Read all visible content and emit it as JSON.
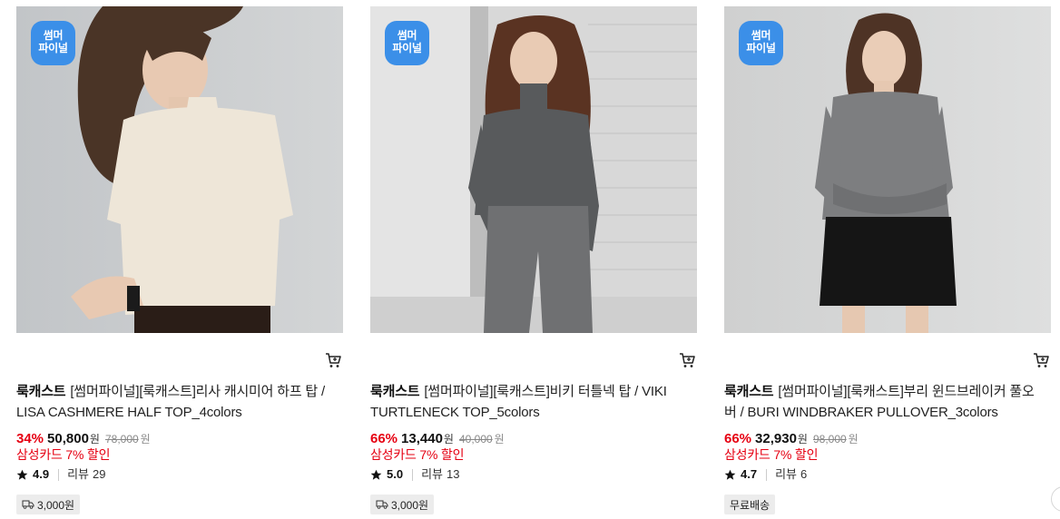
{
  "products": [
    {
      "badge_line1": "썸머",
      "badge_line2": "파이널",
      "brand": "룩캐스트",
      "name": "[썸머파이널][룩캐스트]리사 캐시미어 하프 탑 / LISA CASHMERE HALF TOP_4colors",
      "discount": "34%",
      "price": "50,800",
      "price_unit": "원",
      "original_price": "78,000",
      "original_unit": "원",
      "card_discount": "삼성카드 7% 할인",
      "rating": "4.9",
      "review_label": "리뷰",
      "review_count": "29",
      "shipping": "3,000원",
      "shipping_icon": "truck-icon",
      "colors": {
        "bg": "#c9ccce",
        "top": "#eee6d8",
        "hair": "#4a3426"
      }
    },
    {
      "badge_line1": "썸머",
      "badge_line2": "파이널",
      "brand": "룩캐스트",
      "name": "[썸머파이널][룩캐스트]비키 터틀넥 탑 / VIKI TURTLENECK TOP_5colors",
      "discount": "66%",
      "price": "13,440",
      "price_unit": "원",
      "original_price": "40,000",
      "original_unit": "원",
      "card_discount": "삼성카드 7% 할인",
      "rating": "5.0",
      "review_label": "리뷰",
      "review_count": "13",
      "shipping": "3,000원",
      "shipping_icon": "truck-icon",
      "colors": {
        "bg": "#dadada",
        "top": "#585a5c",
        "hair": "#5a3322"
      }
    },
    {
      "badge_line1": "썸머",
      "badge_line2": "파이널",
      "brand": "룩캐스트",
      "name": "[썸머파이널][룩캐스트]부리 윈드브레이커 풀오버 / BURI WINDBRAKER PULLOVER_3colors",
      "discount": "66%",
      "price": "32,930",
      "price_unit": "원",
      "original_price": "98,000",
      "original_unit": "원",
      "card_discount": "삼성카드 7% 할인",
      "rating": "4.7",
      "review_label": "리뷰",
      "review_count": "6",
      "shipping": "무료배송",
      "shipping_icon": "",
      "colors": {
        "bg": "#d4d5d5",
        "top": "#7d7e80",
        "hair": "#4e3325"
      }
    }
  ],
  "theme": {
    "accent_red": "#e60012",
    "badge_blue": "#3b8fe8"
  }
}
